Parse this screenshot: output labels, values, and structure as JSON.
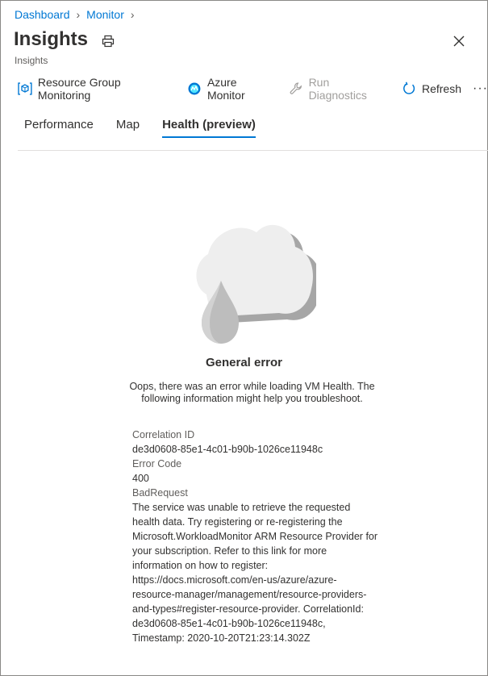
{
  "breadcrumb": {
    "items": [
      "Dashboard",
      "Monitor"
    ]
  },
  "header": {
    "title": "Insights",
    "subtitle": "Insights"
  },
  "toolbar": {
    "items": [
      {
        "label": "Resource Group Monitoring",
        "icon": "resource-group-icon",
        "enabled": true
      },
      {
        "label": "Azure Monitor",
        "icon": "azure-monitor-icon",
        "enabled": true
      },
      {
        "label": "Run Diagnostics",
        "icon": "wrench-icon",
        "enabled": false
      },
      {
        "label": "Refresh",
        "icon": "refresh-icon",
        "enabled": true
      }
    ],
    "more": "···"
  },
  "tabs": [
    {
      "label": "Performance",
      "active": false
    },
    {
      "label": "Map",
      "active": false
    },
    {
      "label": "Health (preview)",
      "active": true
    }
  ],
  "error": {
    "title": "General error",
    "message": "Oops, there was an error while loading VM Health. The following information might help you troubleshoot.",
    "correlation_label": "Correlation ID",
    "correlation_id": "de3d0608-85e1-4c01-b90b-1026ce11948c",
    "code_label": "Error Code",
    "code": "400",
    "reason": "BadRequest",
    "details": "The service was unable to retrieve the requested health data. Try registering or re-registering the Microsoft.WorkloadMonitor ARM Resource Provider for your subscription. Refer to this link for more information on how to register: https://docs.microsoft.com/en-us/azure/azure-resource-manager/management/resource-providers-and-types#register-resource-provider. CorrelationId: de3d0608-85e1-4c01-b90b-1026ce11948c, Timestamp: 2020-10-20T21:23:14.302Z"
  },
  "colors": {
    "accent": "#0078d4",
    "text": "#323130",
    "muted": "#605e5c",
    "disabled": "#a19f9d"
  }
}
